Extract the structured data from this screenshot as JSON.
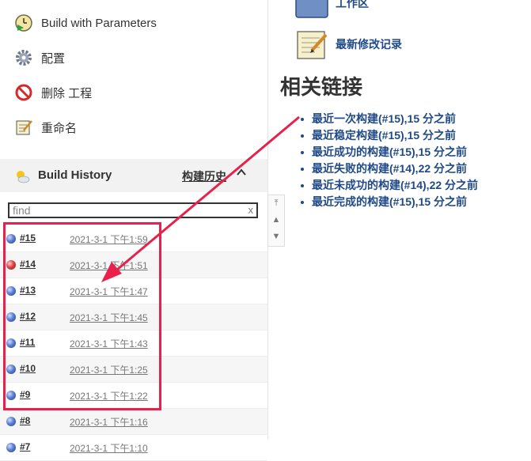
{
  "sidebar": {
    "tasks": [
      {
        "label": "Build with Parameters",
        "icon": "clock-play-icon"
      },
      {
        "label": "配置",
        "icon": "gear-icon"
      },
      {
        "label": "删除 工程",
        "icon": "no-entry-icon"
      },
      {
        "label": "重命名",
        "icon": "notepad-icon"
      }
    ],
    "build_history": {
      "title": "Build History",
      "trend_label": "构建历史",
      "collapse_icon": "chevron-up-icon"
    },
    "filter": {
      "value": "find",
      "clear": "x"
    },
    "builds": [
      {
        "num": "#15",
        "date": "2021-3-1 下午1:59",
        "status": "blue"
      },
      {
        "num": "#14",
        "date": "2021-3-1 下午1:51",
        "status": "red"
      },
      {
        "num": "#13",
        "date": "2021-3-1 下午1:47",
        "status": "blue"
      },
      {
        "num": "#12",
        "date": "2021-3-1 下午1:45",
        "status": "blue"
      },
      {
        "num": "#11",
        "date": "2021-3-1 下午1:43",
        "status": "blue"
      },
      {
        "num": "#10",
        "date": "2021-3-1 下午1:25",
        "status": "blue"
      },
      {
        "num": "#9",
        "date": "2021-3-1 下午1:22",
        "status": "blue"
      },
      {
        "num": "#8",
        "date": "2021-3-1 下午1:16",
        "status": "blue"
      },
      {
        "num": "#7",
        "date": "2021-3-1 下午1:10",
        "status": "blue"
      }
    ]
  },
  "main": {
    "workspace_label": "工作区",
    "changes_label": "最新修改记录",
    "related_title": "相关链接",
    "related_links": [
      "最近一次构建(#15),15 分之前",
      "最近稳定构建(#15),15 分之前",
      "最近成功的构建(#15),15 分之前",
      "最近失败的构建(#14),22 分之前",
      "最近未成功的构建(#14),22 分之前",
      "最近完成的构建(#15),15 分之前"
    ]
  },
  "colors": {
    "link": "#204a87",
    "highlight": "#e8204a"
  }
}
